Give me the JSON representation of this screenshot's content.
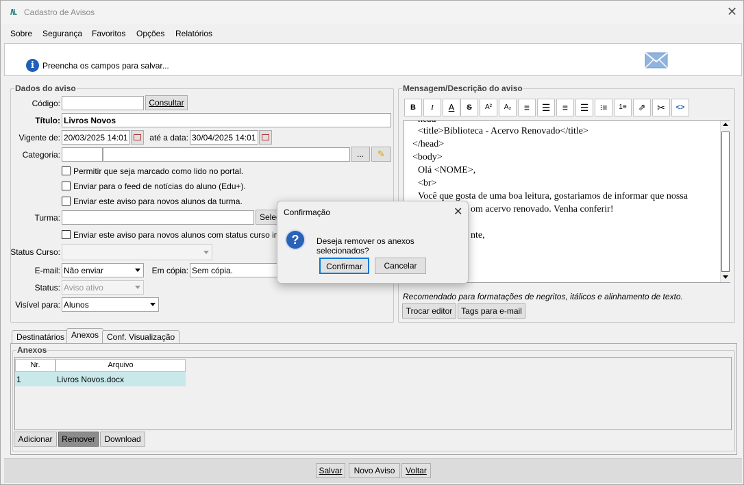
{
  "window": {
    "title": "Cadastro de Avisos"
  },
  "menu": [
    "Sobre",
    "Segurança",
    "Favoritos",
    "Opções",
    "Relatórios"
  ],
  "info": {
    "message": "Preencha os campos para salvar..."
  },
  "dados": {
    "legend": "Dados do aviso",
    "codigo_label": "Código:",
    "codigo_value": "",
    "consultar": "Consultar",
    "titulo_label": "Título:",
    "titulo_value": "Livros Novos",
    "vigente_label": "Vigente de:",
    "vigente_value": "20/03/2025 14:01",
    "ate_label": "até a data:",
    "ate_value": "30/04/2025 14:01",
    "categoria_label": "Categoria:",
    "categoria_btn": "...",
    "check_portal": "Permitir que seja marcado como lido no portal.",
    "check_feed": "Enviar para o feed de notícias do aluno (Edu+).",
    "check_novos": "Enviar este aviso para novos alunos da turma.",
    "turma_label": "Turma:",
    "selec_btn": "Selec",
    "check_status": "Enviar este aviso para novos alunos com status curso ing",
    "status_curso_label": "Status Curso:",
    "email_label": "E-mail:",
    "email_value": "Não enviar",
    "copia_label": "Em cópia:",
    "copia_value": "Sem cópia.",
    "status_label": "Status:",
    "status_value": "Aviso ativo",
    "visivel_label": "Visível para:",
    "visivel_value": "Alunos"
  },
  "mensagem": {
    "legend": "Mensagem/Descrição do aviso",
    "toolbar": [
      "B",
      "I",
      "A",
      "S",
      "A²",
      "A₂",
      "align-left",
      "align-center",
      "align-right",
      "justify",
      "bullet-list",
      "number-list",
      "external-link",
      "cut",
      "code"
    ],
    "lines": [
      "head",
      "<title>Biblioteca - Acervo Renovado</title>",
      "</head>",
      "<body>",
      "Olá <NOME>,",
      "<br>",
      "Você que gosta de uma boa leitura, gostariamos de informar que nossa",
      "om acervo renovado. Venha conferir!",
      "nte,"
    ],
    "hint": "Recomendado para formatações de negritos, itálicos e alinhamento de texto.",
    "trocar": "Trocar editor",
    "tags": "Tags para e-mail"
  },
  "tabs": [
    "Destinatários",
    "Anexos",
    "Conf. Visualização"
  ],
  "anexos": {
    "legend": "Anexos",
    "headers": [
      "Nr.",
      "Arquivo"
    ],
    "rows": [
      {
        "nr": "1",
        "arquivo": "Livros Novos.docx"
      }
    ],
    "buttons": [
      "Adicionar",
      "Remover",
      "Download"
    ]
  },
  "footer": [
    "Salvar",
    "Novo Aviso",
    "Voltar"
  ],
  "dialog": {
    "title": "Confirmação",
    "message": "Deseja remover os anexos selecionados?",
    "confirm": "Confirmar",
    "cancel": "Cancelar"
  },
  "colors": {
    "accent": "#0078d7",
    "selected_row": "#c8e8ea",
    "pressed_button": "#8c8c8c"
  }
}
